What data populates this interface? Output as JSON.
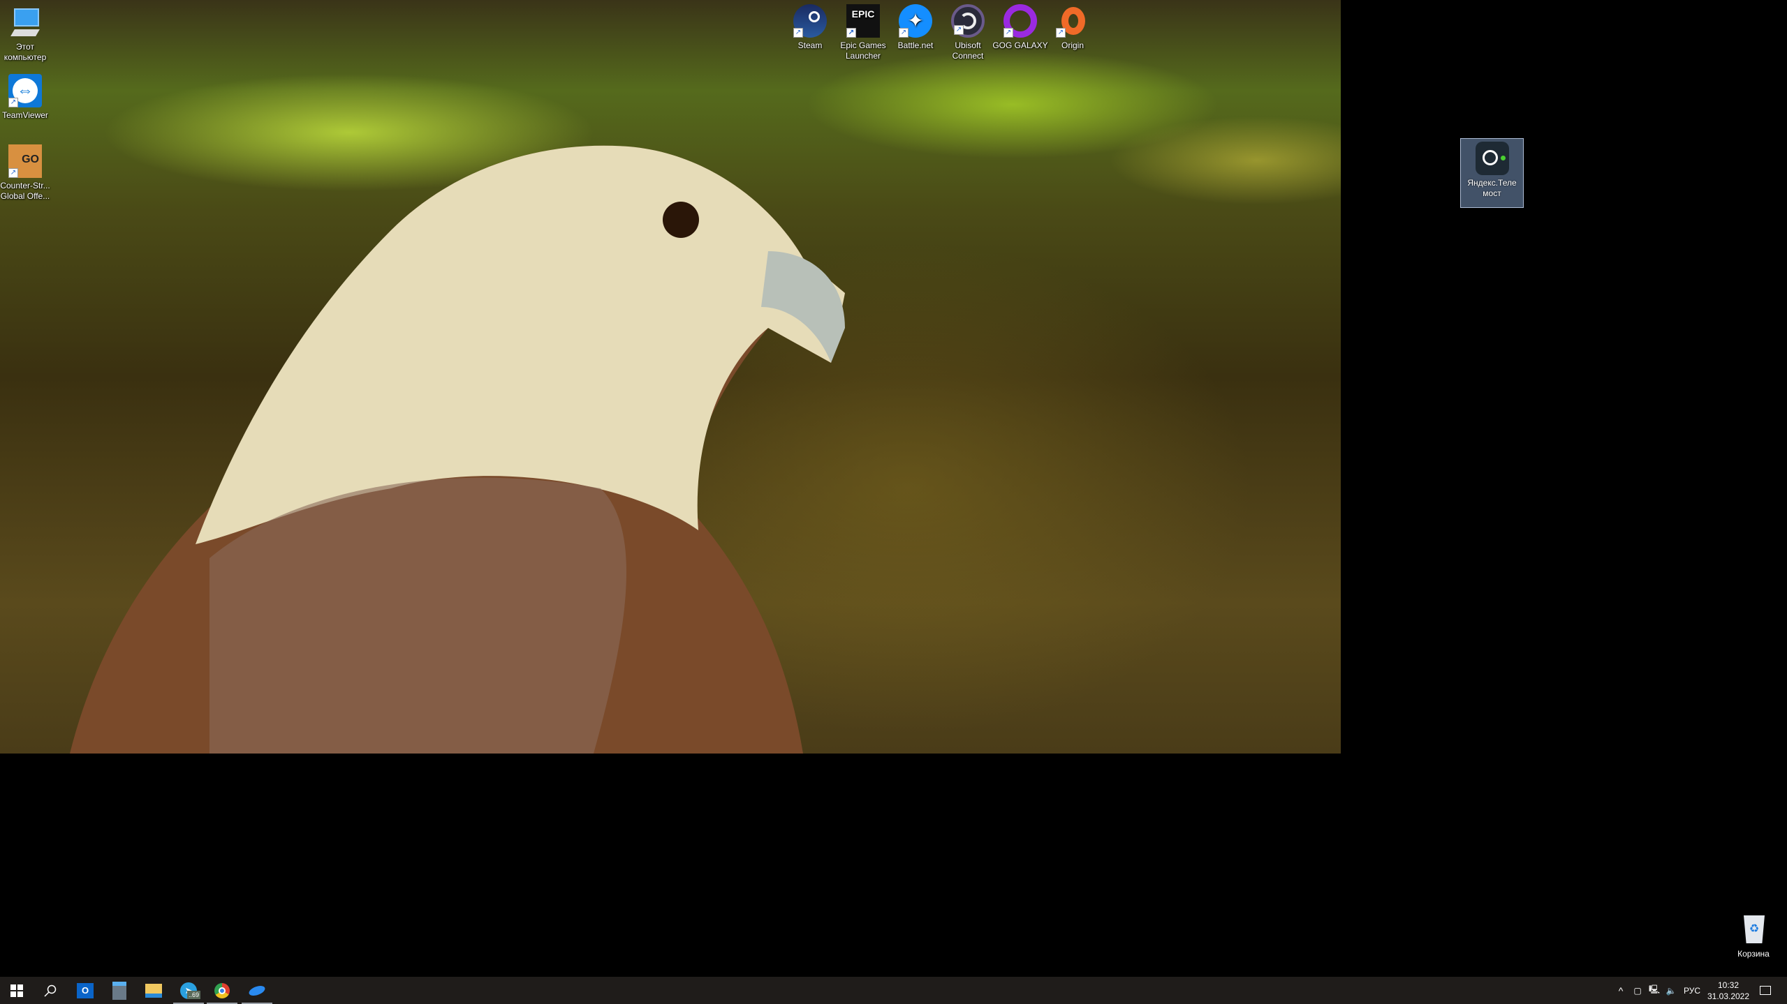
{
  "desktop": {
    "left_icons": [
      {
        "label": "Этот компьютер",
        "icon": "computer-icon"
      },
      {
        "label": "TeamViewer",
        "icon": "teamviewer-icon"
      },
      {
        "label": "Counter-Str... Global Offe...",
        "icon": "csgo-icon"
      }
    ],
    "top_icons": [
      {
        "label": "Steam",
        "icon": "steam-icon"
      },
      {
        "label": "Epic Games Launcher",
        "icon": "epic-games-icon"
      },
      {
        "label": "Battle.net",
        "icon": "battlenet-icon"
      },
      {
        "label": "Ubisoft Connect",
        "icon": "ubisoft-icon"
      },
      {
        "label": "GOG GALAXY",
        "icon": "gog-icon"
      },
      {
        "label": "Origin",
        "icon": "origin-icon"
      }
    ],
    "selected_icon": {
      "label": "Яндекс.Теле мост",
      "icon": "yandex-telemost-icon"
    },
    "recycle_bin": {
      "label": "Корзина",
      "icon": "recycle-bin-icon"
    },
    "epic_logo": "EPIC GAMES",
    "csgo_logo": "GO"
  },
  "taskbar": {
    "apps": [
      {
        "name": "start",
        "icon": "windows-icon"
      },
      {
        "name": "search",
        "icon": "search-icon"
      },
      {
        "name": "outlook",
        "icon": "outlook-icon"
      },
      {
        "name": "calculator",
        "icon": "calculator-icon"
      },
      {
        "name": "explorer",
        "icon": "folder-icon"
      },
      {
        "name": "telegram",
        "icon": "telegram-icon",
        "badge": "..69"
      },
      {
        "name": "chrome",
        "icon": "chrome-icon"
      },
      {
        "name": "app",
        "icon": "app-icon"
      }
    ],
    "language": "РУС",
    "time": "10:32",
    "date": "31.03.2022"
  },
  "colors": {
    "taskbar": "#1f1c1a",
    "accent": "#2a6ad0"
  }
}
